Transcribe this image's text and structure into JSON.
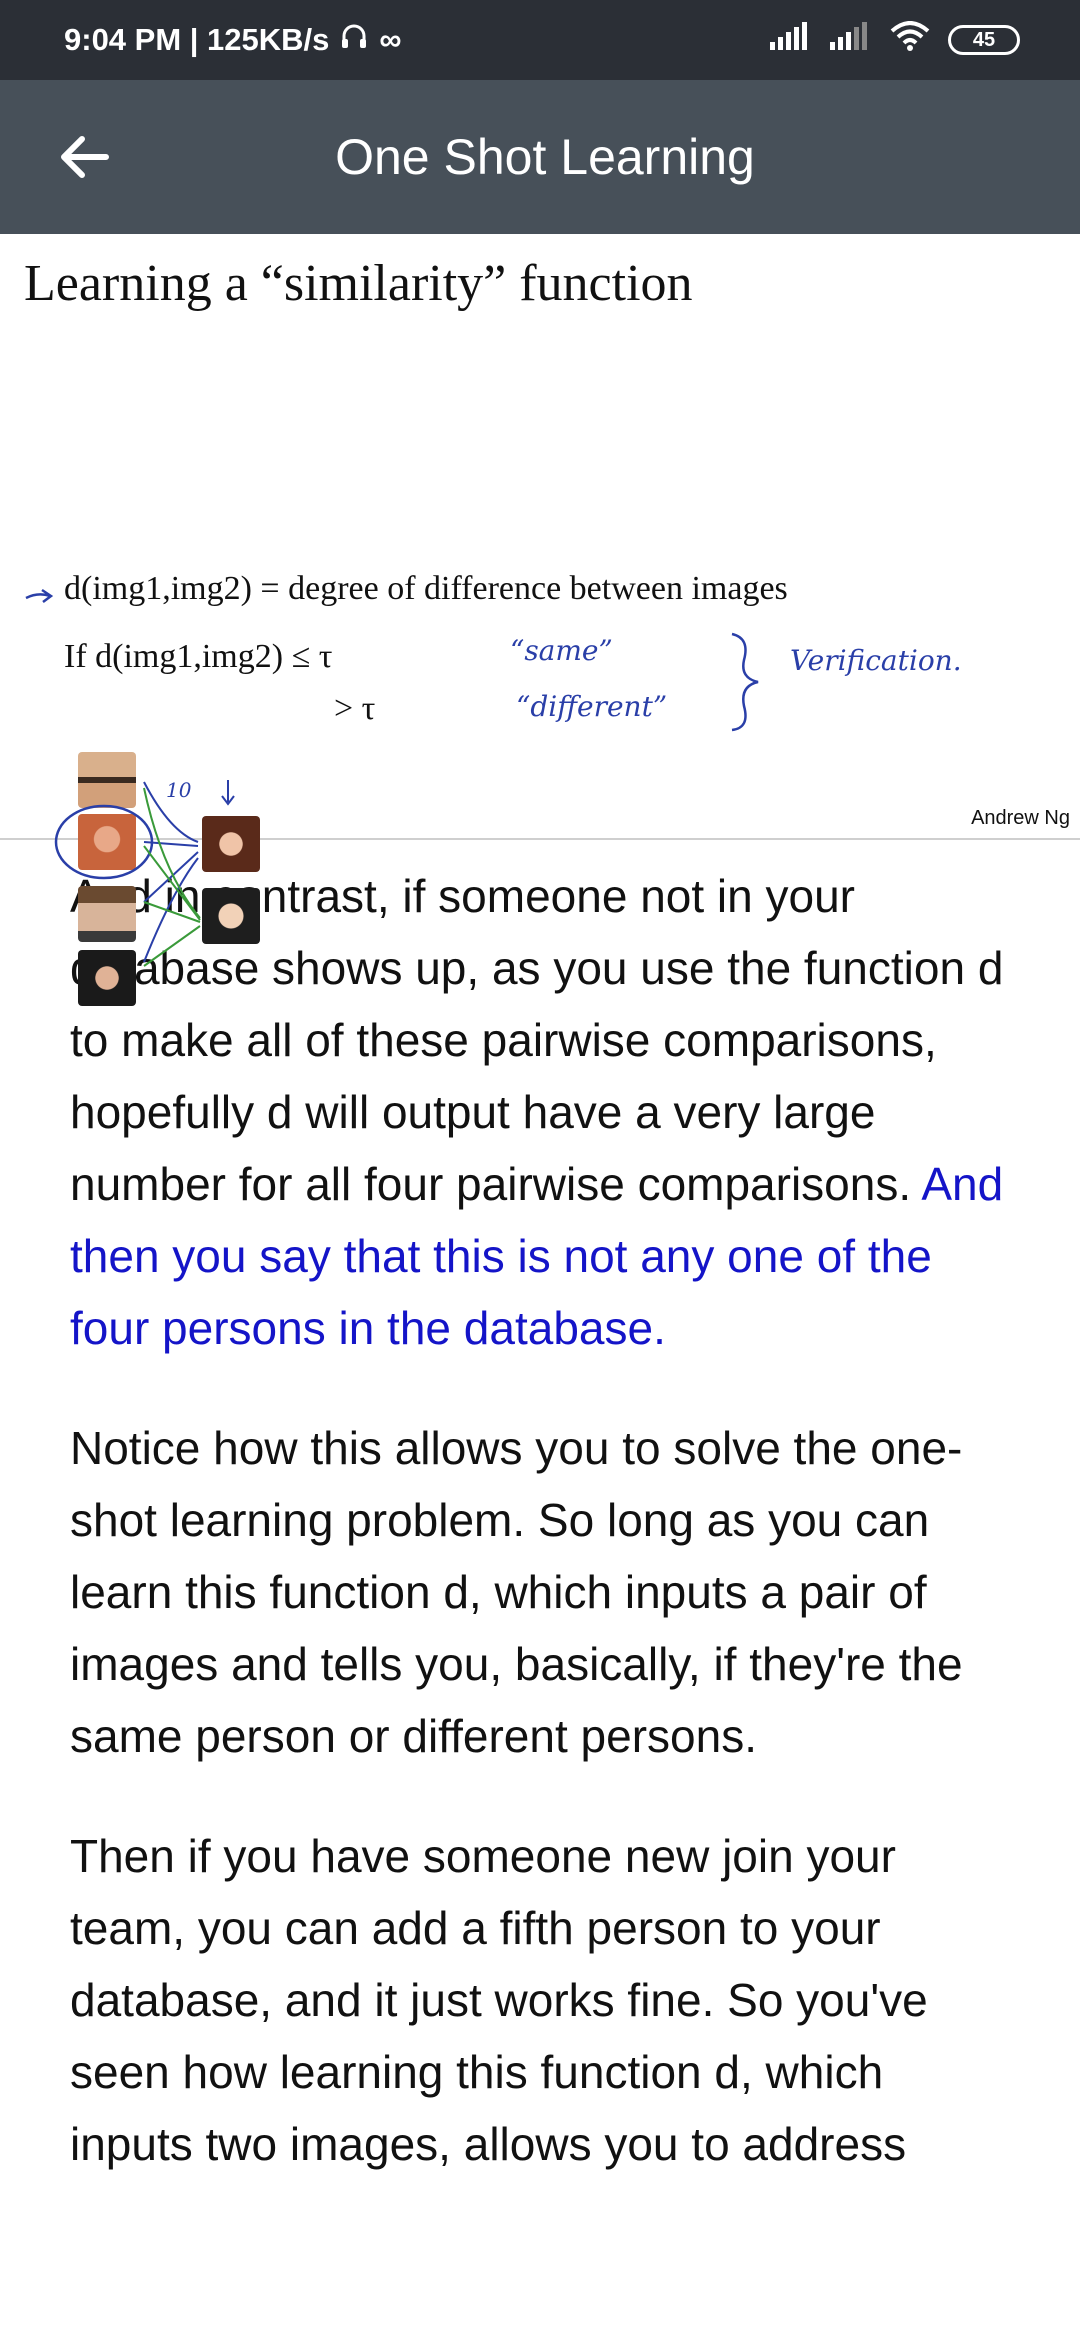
{
  "status_bar": {
    "time_speed": "9:04 PM | 125KB/s",
    "infinity": "∞",
    "battery": "45"
  },
  "app_bar": {
    "title": "One Shot Learning"
  },
  "slide": {
    "title": "Learning a “similarity” function",
    "line1": "d(img1,img2) = degree of difference between images",
    "line2": "If d(img1,img2) ≤ τ",
    "line3": "> τ",
    "annot_same": "“same”",
    "annot_different": "“different”",
    "annot_verification": "Verification.",
    "annot_ten": "10",
    "credit": "Andrew Ng"
  },
  "transcript": {
    "p1_normal": "And in contrast, if someone not in your database shows up, as you use the function d to make all of these pairwise comparisons, hopefully d will output have a very large number for all four pairwise comparisons. ",
    "p1_highlight": "And then you say that this is not any one of the four persons in the database.",
    "p2": "Notice how this allows you to solve the one-shot learning problem. So long as you can learn this function d, which inputs a pair of images and tells you, basically, if they're the same person or different persons.",
    "p3": "Then if you have someone new join your team, you can add a fifth person to your database, and it just works fine. So you've seen how learning this function d, which inputs two images, allows you to address"
  },
  "colors": {
    "status_bar_bg": "#2b2f36",
    "app_bar_bg": "#475059",
    "highlight_text": "#1414c8",
    "annotation_blue": "#2a3fa8",
    "annotation_green": "#3a9a3a"
  }
}
